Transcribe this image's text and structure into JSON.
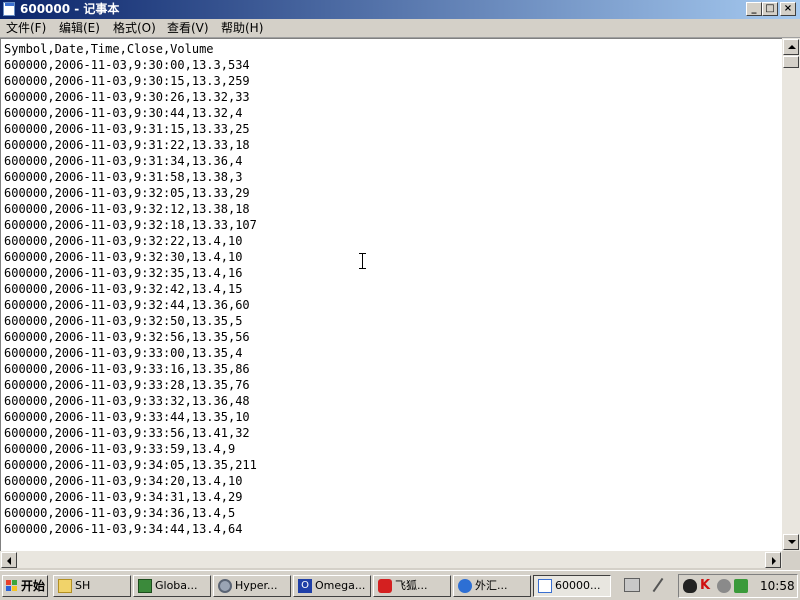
{
  "window": {
    "title": "600000 - 记事本",
    "minimize_label": "_",
    "maximize_label": "□",
    "close_label": "×"
  },
  "menu": [
    {
      "label": "文件(F)"
    },
    {
      "label": "编辑(E)"
    },
    {
      "label": "格式(O)"
    },
    {
      "label": "查看(V)"
    },
    {
      "label": "帮助(H)"
    }
  ],
  "document": {
    "lines": [
      "Symbol,Date,Time,Close,Volume",
      "600000,2006-11-03,9:30:00,13.3,534",
      "600000,2006-11-03,9:30:15,13.3,259",
      "600000,2006-11-03,9:30:26,13.32,33",
      "600000,2006-11-03,9:30:44,13.32,4",
      "600000,2006-11-03,9:31:15,13.33,25",
      "600000,2006-11-03,9:31:22,13.33,18",
      "600000,2006-11-03,9:31:34,13.36,4",
      "600000,2006-11-03,9:31:58,13.38,3",
      "600000,2006-11-03,9:32:05,13.33,29",
      "600000,2006-11-03,9:32:12,13.38,18",
      "600000,2006-11-03,9:32:18,13.33,107",
      "600000,2006-11-03,9:32:22,13.4,10",
      "600000,2006-11-03,9:32:30,13.4,10",
      "600000,2006-11-03,9:32:35,13.4,16",
      "600000,2006-11-03,9:32:42,13.4,15",
      "600000,2006-11-03,9:32:44,13.36,60",
      "600000,2006-11-03,9:32:50,13.35,5",
      "600000,2006-11-03,9:32:56,13.35,56",
      "600000,2006-11-03,9:33:00,13.35,4",
      "600000,2006-11-03,9:33:16,13.35,86",
      "600000,2006-11-03,9:33:28,13.35,76",
      "600000,2006-11-03,9:33:32,13.36,48",
      "600000,2006-11-03,9:33:44,13.35,10",
      "600000,2006-11-03,9:33:56,13.41,32",
      "600000,2006-11-03,9:33:59,13.4,9",
      "600000,2006-11-03,9:34:05,13.35,211",
      "600000,2006-11-03,9:34:20,13.4,10",
      "600000,2006-11-03,9:34:31,13.4,29",
      "600000,2006-11-03,9:34:36,13.4,5",
      "600000,2006-11-03,9:34:44,13.4,64"
    ]
  },
  "taskbar": {
    "start_label": "开始",
    "tasks": [
      {
        "label": "SH",
        "icon": "folder-icon"
      },
      {
        "label": "Globa...",
        "icon": "globe-app-icon"
      },
      {
        "label": "Hyper...",
        "icon": "gear-icon"
      },
      {
        "label": "Omega...",
        "icon": "omega-app-icon"
      },
      {
        "label": "飞狐...",
        "icon": "fox-app-icon"
      },
      {
        "label": "外汇...",
        "icon": "browser-icon"
      },
      {
        "label": "60000...",
        "icon": "notepad-icon"
      }
    ],
    "clock": "10:58"
  },
  "colors": {
    "title_gradient_start": "#0a246a",
    "title_gradient_end": "#a6caf0",
    "chrome": "#d4d0c8",
    "editor_bg": "#ffffff"
  }
}
